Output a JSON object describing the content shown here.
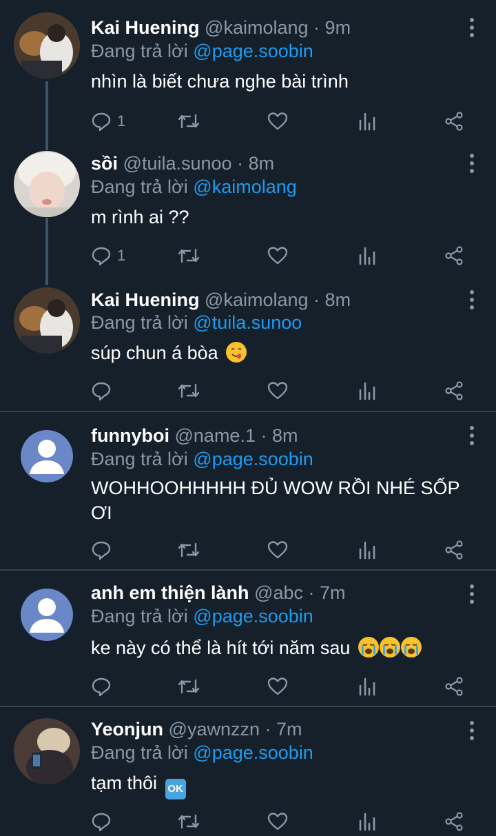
{
  "tweets": [
    {
      "name": "Kai Huening",
      "handle": "@kaimolang",
      "dot": "·",
      "time": "9m",
      "reply_prefix": "Đang trả lời",
      "reply_to": "@page.soobin",
      "text": "nhìn là biết chưa nghe bài trình",
      "reply_count": "1"
    },
    {
      "name": "sồi",
      "handle": "@tuila.sunoo",
      "dot": "·",
      "time": "8m",
      "reply_prefix": "Đang trả lời",
      "reply_to": "@kaimolang",
      "text": "m rình ai ??",
      "reply_count": "1"
    },
    {
      "name": "Kai Huening",
      "handle": "@kaimolang",
      "dot": "·",
      "time": "8m",
      "reply_prefix": "Đang trả lời",
      "reply_to": "@tuila.sunoo",
      "text": "súp chun á bòa",
      "emoji": "😋"
    },
    {
      "name": "funnyboi",
      "handle": "@name.1",
      "dot": "·",
      "time": "8m",
      "reply_prefix": "Đang trả lời",
      "reply_to": "@page.soobin",
      "text_line1": "WOHHOOHHHHH ĐỦ WOW RỒI NHÉ SỐP",
      "text_line2": "ƠI"
    },
    {
      "name": "anh em thiện lành",
      "handle": "@abc",
      "dot": "·",
      "time": "7m",
      "reply_prefix": "Đang trả lời",
      "reply_to": "@page.soobin",
      "text": "ke này có thể là hít tới năm sau",
      "emoji": "😭😭😭"
    },
    {
      "name": "Yeonjun",
      "handle": "@yawnzzn",
      "dot": "·",
      "time": "7m",
      "reply_prefix": "Đang trả lời",
      "reply_to": "@page.soobin",
      "text": "tạm thôi",
      "emoji_ok": "OK"
    }
  ],
  "icons": {
    "reply": "reply-icon",
    "retweet": "retweet-icon",
    "like": "heart-icon",
    "analytics": "analytics-icon",
    "share": "share-icon",
    "more": "more-vertical-icon"
  },
  "colors": {
    "background": "#15202b",
    "muted": "#8899a6",
    "link": "#1d9bf0",
    "separator": "#38444d",
    "thread_line": "#3d5466"
  }
}
